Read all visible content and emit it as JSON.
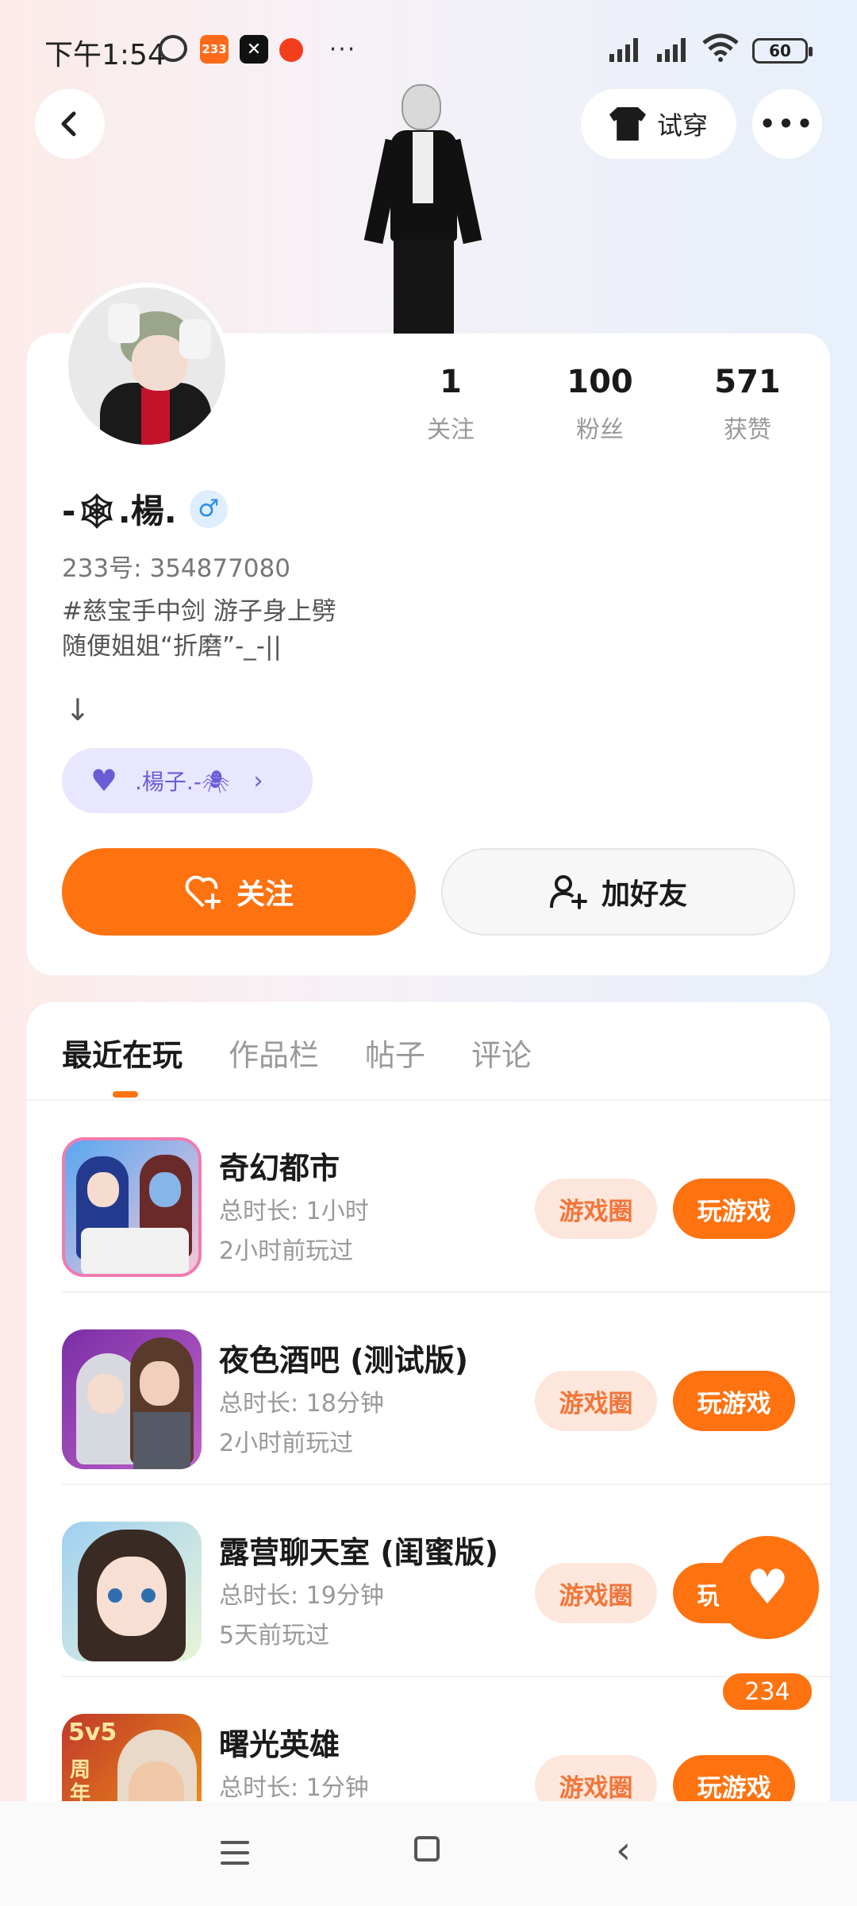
{
  "status_bar": {
    "time": "下午1:54",
    "app_233": "233",
    "battery": "60"
  },
  "header": {
    "try_on_label": "试穿"
  },
  "profile": {
    "stats": [
      {
        "value": "1",
        "label": "关注"
      },
      {
        "value": "100",
        "label": "粉丝"
      },
      {
        "value": "571",
        "label": "获赞"
      }
    ],
    "username": "-🕸.楊.",
    "gender_symbol": "♂",
    "uid": "233号: 354877080",
    "bio": "#慈宝手中剑 游子身上劈\n随便姐姐“折磨”-_-||",
    "arrow": "↓",
    "tag_label": ".楊子.-🕷",
    "follow_label": "关注",
    "add_friend_label": "加好友"
  },
  "tabs": [
    {
      "label": "最近在玩"
    },
    {
      "label": "作品栏"
    },
    {
      "label": "帖子"
    },
    {
      "label": "评论"
    }
  ],
  "games": [
    {
      "name": "奇幻都市",
      "duration": "总时长: 1小时",
      "last_played": "2小时前玩过",
      "circle_label": "游戏圈",
      "play_label": "玩游戏"
    },
    {
      "name": "夜色酒吧 (测试版)",
      "duration": "总时长: 18分钟",
      "last_played": "2小时前玩过",
      "circle_label": "游戏圈",
      "play_label": "玩游戏"
    },
    {
      "name": "露营聊天室 (闺蜜版)",
      "duration": "总时长: 19分钟",
      "last_played": "5天前玩过",
      "circle_label": "游戏圈",
      "play_label": "玩游戏"
    },
    {
      "name": "曙光英雄",
      "duration": "总时长: 1分钟",
      "last_played": "",
      "circle_label": "游戏圈",
      "play_label": "玩游戏"
    }
  ],
  "like_fab": {
    "count": "234"
  },
  "colors": {
    "accent": "#ff7210",
    "tag_purple": "#6a5cd6"
  }
}
